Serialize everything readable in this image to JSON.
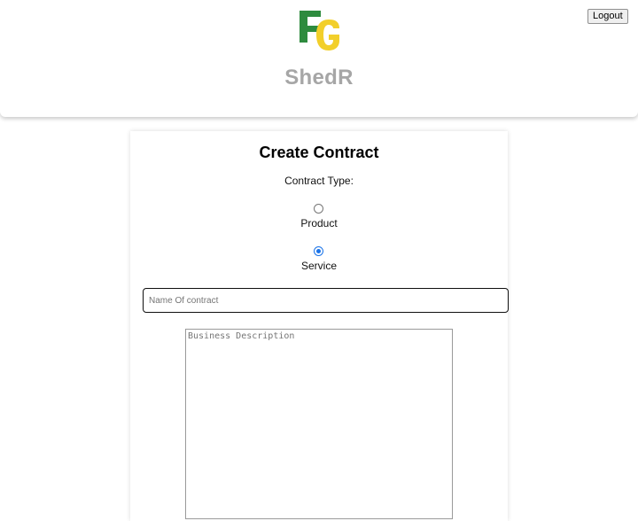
{
  "header": {
    "logo_icon": "fg-logo-icon",
    "brand": "ShedR",
    "logout_label": "Logout"
  },
  "colors": {
    "logo_green": "#2e8b3e",
    "logo_yellow": "#f2cf2b",
    "brand_gray": "#a6a6a6",
    "radio_accent": "#1a73e8"
  },
  "form": {
    "title": "Create Contract",
    "contract_type_label": "Contract Type:",
    "options": [
      {
        "label": "Product",
        "selected": false
      },
      {
        "label": "Service",
        "selected": true
      }
    ],
    "name_placeholder": "Name Of contract",
    "name_value": "",
    "description_placeholder": "Business Description",
    "description_value": ""
  }
}
